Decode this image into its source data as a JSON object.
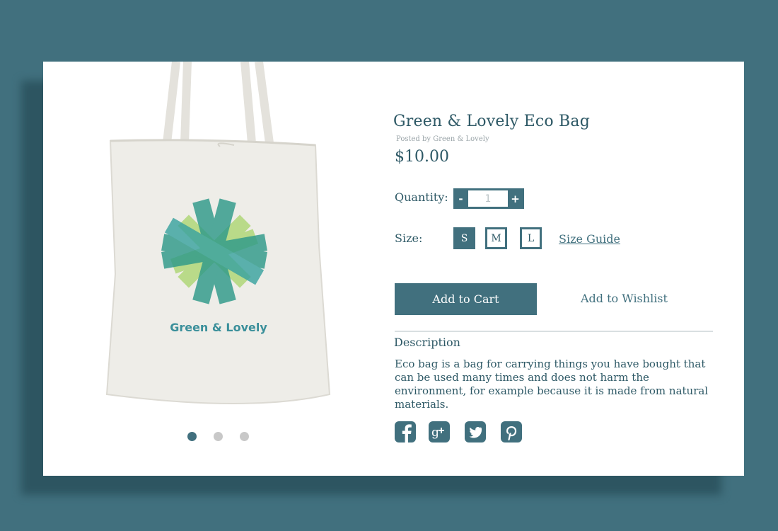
{
  "product": {
    "title": "Green & Lovely Eco Bag",
    "posted_by": "Posted by Green & Lovely",
    "price": "$10.00",
    "image_logo_text": "Green & Lovely"
  },
  "carousel": {
    "total_slides": 3,
    "active_slide": 1
  },
  "quantity": {
    "label": "Quantity:",
    "minus": "-",
    "plus": "+",
    "placeholder": "1"
  },
  "size": {
    "label": "Size:",
    "options": [
      "S",
      "M",
      "L"
    ],
    "selected": "S",
    "guide_label": "Size Guide"
  },
  "actions": {
    "add_to_cart": "Add to Cart",
    "add_to_wishlist": "Add to Wishlist"
  },
  "description": {
    "heading": "Description",
    "text": "Eco bag is a bag for carrying things you have bought that can be used many times and does not harm the environment, for example because it is made from natural materials."
  },
  "social": [
    "facebook-icon",
    "google-plus-icon",
    "twitter-icon",
    "pinterest-icon"
  ],
  "colors": {
    "background": "#41707e",
    "accent": "#41707e",
    "text": "#2e5966",
    "card": "#ffffff"
  }
}
